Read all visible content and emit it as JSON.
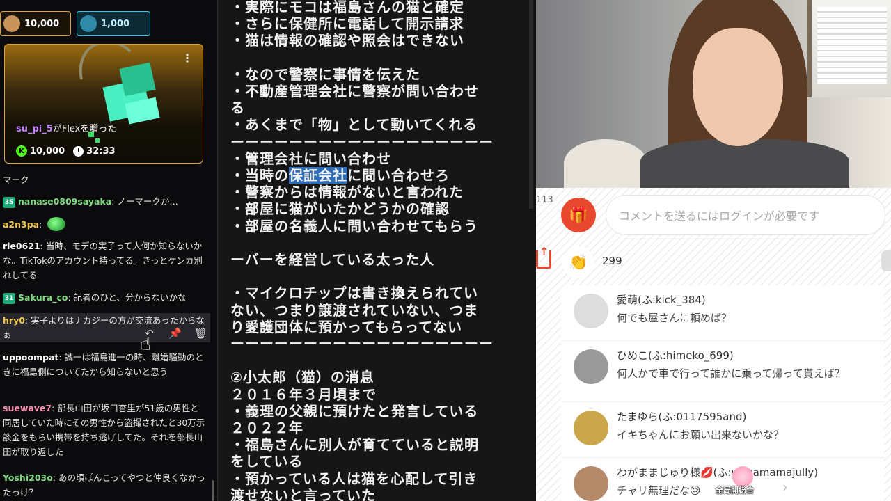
{
  "chat": {
    "gift_chips": [
      {
        "amount": "10,000"
      },
      {
        "amount": "1,000"
      }
    ],
    "flex_card": {
      "menu_icon": "⋮",
      "user": "su_pi_5",
      "action": "がFlexを贈った",
      "k_badge": "K",
      "amount": "10,000",
      "duration": "32:33"
    },
    "messages": [
      {
        "user": "",
        "text": "マーク",
        "color": "#e8e8e8"
      },
      {
        "badge": "35",
        "user": "nanase0809sayaka",
        "sep": ": ",
        "text": "ノーマークか…",
        "color": "#7fdc7f"
      },
      {
        "user": "a2n3pa",
        "sep": ": ",
        "text": "",
        "emote": true,
        "color": "#f3c74b"
      },
      {
        "user": "rie0621",
        "sep": ": ",
        "text": "当時、モデの実子って人何か知らないかな。TikTokのアカウント持ってる。きっとケンカ別れしてる",
        "color": "#ffffff"
      },
      {
        "badge": "31",
        "user": "Sakura_co",
        "sep": ": ",
        "text": "記者のひと、分からないかな",
        "color": "#7fdc7f"
      },
      {
        "user": "hry0",
        "sep": ": ",
        "text": "実子よりはナカジーの方が交流あったからなぁ",
        "color": "#f3c74b"
      },
      {
        "user": "uppoompat",
        "sep": ": ",
        "text": "誠一は福島進一の時、離婚騒動のときに福島側についてたから知らないと思う",
        "color": "#ffffff"
      },
      {
        "user": "suewave7",
        "sep": ": ",
        "text": "部長山田が坂口杏里が51歳の男性と同居していた時にその男性から盗撮されたと30万示談金をもらい携帯を持ち逃げしてた。それを部長山田が取り返した",
        "color": "#ff8fb1"
      },
      {
        "user": "Yoshi203o",
        "sep": ": ",
        "text": "あの頃ぽんこってやつと仲良くなかったっけ？",
        "color": "#7fdc7f"
      }
    ],
    "actions": {
      "reply_icon": "↶",
      "pin_icon": "📌",
      "delete_icon": "🗑"
    }
  },
  "notes": {
    "lines": [
      "・実際にモコは福島さんの猫と確定",
      "・さらに保健所に電話して開示請求",
      "・猫は情報の確認や照会はできない",
      "",
      "・なので警察に事情を伝えた",
      "・不動産管理会社に警察が問い合わせ",
      "る",
      "・あくまで「物」として動いてくれる",
      "ーーーーーーーーーーーーーーーーーー",
      "・管理会社に問い合わせ",
      "・当時の保証会社に問い合わせろ",
      "・警察からは情報がないと言われた",
      "・部屋に猫がいたかどうかの確認",
      "・部屋の名義人に問い合わせてもらう",
      "",
      "ーバーを経営している太った人",
      "",
      "・マイクロチップは書き換えられてい",
      "ない、つまり譲渡されていない、つま",
      "り愛護団体に預かってもらってない",
      "ーーーーーーーーーーーーーーーーーー",
      "",
      "②小太郎（猫）の消息",
      "２０１６年３月頃まで",
      "・義理の父親に預けたと発言している",
      "２０２２年",
      "・福島さんに別人が育てていると説明",
      "をしている",
      "・預かっている人は猫を心配して引き",
      "渡せないと言っていた"
    ],
    "highlight": {
      "before": "・当時の",
      "mark": "保証会社",
      "after": "に問い合わせろ"
    }
  },
  "right": {
    "viewer_count": "113",
    "gift_icon": "🎁",
    "comment_placeholder": "コメントを送るにはログインが必要です",
    "clap_icon": "👏",
    "clap_count": "299",
    "comments": [
      {
        "name": "愛萌(ふ:kick_384)",
        "text": "何でも屋さんに頼めば？",
        "avatar_color": "#e4e4e4"
      },
      {
        "name": "ひめこ(ふ:himeko_699)",
        "text": "何人かで車で行って誰かに乗って帰って貰えば？",
        "avatar_color": "#9a9a9a"
      },
      {
        "name": "たまゆら(ふ:0117595and)",
        "text": "イキちゃんにお願い出来ないかな？",
        "avatar_color": "#c9a74a"
      },
      {
        "name": "わがままじゅり様💋(ふ:wagamamajully)",
        "text": "チャリ無理だな😥",
        "avatar_color": "#b58a6a"
      }
    ],
    "sticker_label": "全局開総合",
    "prev_icon": "‹",
    "next_icon": "›"
  }
}
